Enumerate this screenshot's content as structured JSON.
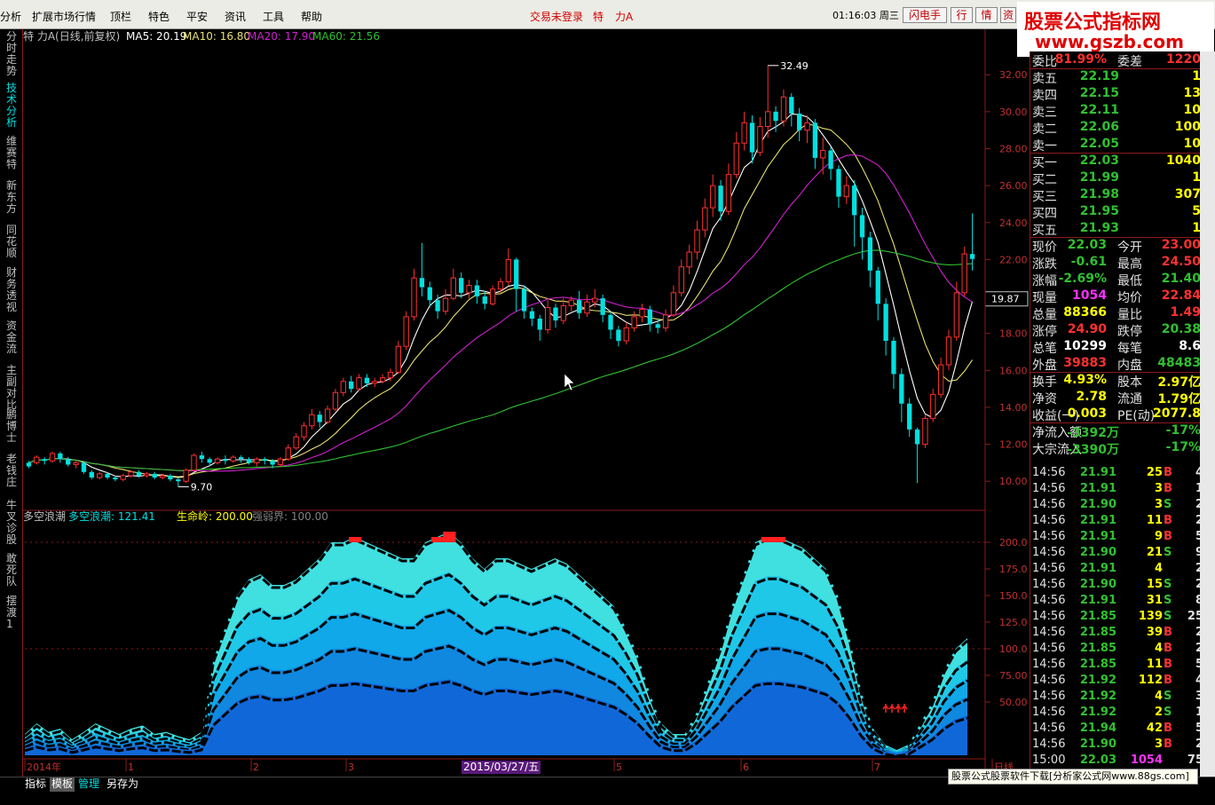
{
  "menubar": {
    "items": [
      "分析",
      "扩展市场行情",
      "顶栏",
      "特色",
      "平安",
      "资讯",
      "工具",
      "帮助"
    ],
    "center_items": [
      "交易未登录",
      "特",
      "力A"
    ],
    "clock": "01:16:03 周三",
    "buttons": [
      "闪电手",
      "行",
      "情",
      "资"
    ]
  },
  "brand": {
    "line1": "股票公式指标网",
    "line2": "www.gszb.com"
  },
  "side_tabs": [
    "分时走势",
    "技术分析",
    "维赛特",
    "新东方",
    "同花顺",
    "财务透视",
    "资金流",
    "主副对比",
    "鹏博士",
    "老钱庄",
    "牛叉诊股",
    "敢死队",
    "摆渡1"
  ],
  "main_chart": {
    "header": {
      "name": "特  力A(日线,前复权)",
      "ma5": "MA5: 20.19",
      "ma10": "MA10: 16.80",
      "ma20": "MA20: 17.90",
      "ma60": "MA60: 21.56"
    },
    "price_axis_ticks": [
      "32.00",
      "30.00",
      "28.00",
      "26.00",
      "24.00",
      "22.00",
      "20.00",
      "18.00",
      "16.00",
      "14.00",
      "12.00",
      "10.00"
    ],
    "price_min": 9.0,
    "price_max": 33.5,
    "high_marker": "32.49",
    "low_marker": "9.70",
    "cursor_price": "19.87",
    "colors": {
      "up": "#ff3030",
      "down": "#00e0e0",
      "ma5": "#ffffff",
      "ma10": "#e8e070",
      "ma20": "#d020d0",
      "ma60": "#30c030"
    }
  },
  "indicator": {
    "title": "多空浪潮",
    "value_label": "多空浪潮: 121.41",
    "life_label": "生命岭: 200.00",
    "strength_label": "强弱界: 100.00",
    "axis_ticks": [
      "200.0",
      "175.0",
      "150.0",
      "125.0",
      "100.0",
      "75.00",
      "50.00"
    ],
    "max": 215,
    "wave_values": [
      20,
      30,
      22,
      25,
      15,
      22,
      30,
      25,
      20,
      25,
      28,
      20,
      22,
      18,
      15,
      22,
      90,
      120,
      150,
      165,
      170,
      160,
      160,
      165,
      175,
      185,
      200,
      200,
      205,
      200,
      195,
      190,
      185,
      185,
      200,
      205,
      210,
      200,
      185,
      175,
      185,
      185,
      180,
      175,
      180,
      185,
      180,
      170,
      160,
      150,
      140,
      120,
      95,
      60,
      30,
      20,
      20,
      40,
      70,
      100,
      140,
      170,
      200,
      205,
      205,
      200,
      195,
      185,
      175,
      150,
      110,
      60,
      25,
      10,
      5,
      10,
      30,
      50,
      80,
      100,
      110
    ]
  },
  "time_axis": {
    "labels": [
      "2014年",
      "1",
      "2",
      "3",
      "2015/03/27/五",
      "5",
      "6",
      "7",
      "日线"
    ]
  },
  "quote": {
    "rows": [
      {
        "k": "委比",
        "v": "81.99%",
        "k2": "委差",
        "v2": "1220",
        "vc": "#ff3030",
        "v2c": "#ff3030"
      },
      {
        "k": "卖五",
        "v": "22.19",
        "v2": "1",
        "vc": "#30c030",
        "v2c": "#ffff00"
      },
      {
        "k": "卖四",
        "v": "22.15",
        "v2": "13",
        "vc": "#30c030",
        "v2c": "#ffff00"
      },
      {
        "k": "卖三",
        "v": "22.11",
        "v2": "10",
        "vc": "#30c030",
        "v2c": "#ffff00"
      },
      {
        "k": "卖二",
        "v": "22.06",
        "v2": "100",
        "vc": "#30c030",
        "v2c": "#ffff00"
      },
      {
        "k": "卖一",
        "v": "22.05",
        "v2": "10",
        "vc": "#30c030",
        "v2c": "#ffff00"
      },
      {
        "k": "买一",
        "v": "22.03",
        "v2": "1040",
        "vc": "#30c030",
        "v2c": "#ffff00"
      },
      {
        "k": "买二",
        "v": "21.99",
        "v2": "1",
        "vc": "#30c030",
        "v2c": "#ffff00"
      },
      {
        "k": "买三",
        "v": "21.98",
        "v2": "307",
        "vc": "#30c030",
        "v2c": "#ffff00"
      },
      {
        "k": "买四",
        "v": "21.95",
        "v2": "5",
        "vc": "#30c030",
        "v2c": "#ffff00"
      },
      {
        "k": "买五",
        "v": "21.93",
        "v2": "1",
        "vc": "#30c030",
        "v2c": "#ffff00"
      },
      {
        "k": "现价",
        "v": "22.03",
        "k2": "今开",
        "v2": "23.00",
        "vc": "#30c030",
        "v2c": "#ff3030"
      },
      {
        "k": "涨跌",
        "v": "-0.61",
        "k2": "最高",
        "v2": "24.50",
        "vc": "#30c030",
        "v2c": "#ff3030"
      },
      {
        "k": "涨幅",
        "v": "-2.69%",
        "k2": "最低",
        "v2": "21.40",
        "vc": "#30c030",
        "v2c": "#30c030"
      },
      {
        "k": "现量",
        "v": "1054",
        "k2": "均价",
        "v2": "22.84",
        "vc": "#ff30ff",
        "v2c": "#ff3030"
      },
      {
        "k": "总量",
        "v": "88366",
        "k2": "量比",
        "v2": "1.49",
        "vc": "#ffff00",
        "v2c": "#ff3030"
      },
      {
        "k": "涨停",
        "v": "24.90",
        "k2": "跌停",
        "v2": "20.38",
        "vc": "#ff3030",
        "v2c": "#30c030"
      },
      {
        "k": "总笔",
        "v": "10299",
        "k2": "每笔",
        "v2": "8.6",
        "vc": "#ffffff",
        "v2c": "#ffffff"
      },
      {
        "k": "外盘",
        "v": "39883",
        "k2": "内盘",
        "v2": "48483",
        "vc": "#ff3030",
        "v2c": "#30c030"
      },
      {
        "k": "换手",
        "v": "4.93%",
        "k2": "股本",
        "v2": "2.97亿",
        "vc": "#ffff00",
        "v2c": "#ffff00"
      },
      {
        "k": "净资",
        "v": "2.78",
        "k2": "流通",
        "v2": "1.79亿",
        "vc": "#ffff00",
        "v2c": "#ffff00"
      },
      {
        "k": "收益(一)",
        "v": "0.003",
        "k2": "PE(动)",
        "v2": "2077.8",
        "vc": "#ffff00",
        "v2c": "#ffff00"
      },
      {
        "k": "净流入额",
        "v": "-3392万",
        "v2": "-17%",
        "vc": "#30c030",
        "v2c": "#30c030"
      },
      {
        "k": "大宗流入",
        "v": "-3390万",
        "v2": "-17%",
        "vc": "#30c030",
        "v2c": "#30c030"
      }
    ]
  },
  "ticks": [
    {
      "t": "14:56",
      "p": "21.91",
      "v": "25",
      "s": "B",
      "n": "4"
    },
    {
      "t": "14:56",
      "p": "21.91",
      "v": "3",
      "s": "B",
      "n": "1"
    },
    {
      "t": "14:56",
      "p": "21.90",
      "v": "3",
      "s": "S",
      "n": "2"
    },
    {
      "t": "14:56",
      "p": "21.91",
      "v": "11",
      "s": "B",
      "n": "2"
    },
    {
      "t": "14:56",
      "p": "21.91",
      "v": "9",
      "s": "B",
      "n": "5"
    },
    {
      "t": "14:56",
      "p": "21.90",
      "v": "21",
      "s": "S",
      "n": "9"
    },
    {
      "t": "14:56",
      "p": "21.91",
      "v": "4",
      "s": "",
      "n": "2"
    },
    {
      "t": "14:56",
      "p": "21.90",
      "v": "15",
      "s": "S",
      "n": "2"
    },
    {
      "t": "14:56",
      "p": "21.91",
      "v": "31",
      "s": "S",
      "n": "8"
    },
    {
      "t": "14:56",
      "p": "21.85",
      "v": "139",
      "s": "S",
      "n": "25"
    },
    {
      "t": "14:56",
      "p": "21.85",
      "v": "39",
      "s": "B",
      "n": "2"
    },
    {
      "t": "14:56",
      "p": "21.85",
      "v": "4",
      "s": "B",
      "n": "2"
    },
    {
      "t": "14:56",
      "p": "21.85",
      "v": "11",
      "s": "B",
      "n": "5"
    },
    {
      "t": "14:56",
      "p": "21.92",
      "v": "112",
      "s": "B",
      "n": "4"
    },
    {
      "t": "14:56",
      "p": "21.92",
      "v": "4",
      "s": "S",
      "n": "3"
    },
    {
      "t": "14:56",
      "p": "21.92",
      "v": "2",
      "s": "S",
      "n": "1"
    },
    {
      "t": "14:56",
      "p": "21.94",
      "v": "42",
      "s": "B",
      "n": "5"
    },
    {
      "t": "14:56",
      "p": "21.90",
      "v": "3",
      "s": "B",
      "n": "2"
    },
    {
      "t": "15:00",
      "p": "22.03",
      "v": "1054",
      "s": "",
      "n": "75"
    }
  ],
  "bottom_tabs": [
    "指标",
    "模板",
    "管理",
    "另存为"
  ],
  "footer_ad": "股票公式股票软件下载[分析家公式网www.88gs.com]",
  "candles": [
    [
      10.8,
      11.0,
      10.7,
      11.1,
      "d"
    ],
    [
      11.0,
      11.3,
      10.9,
      11.4,
      "u"
    ],
    [
      11.2,
      11.1,
      10.9,
      11.3,
      "d"
    ],
    [
      11.1,
      11.5,
      11.0,
      11.6,
      "u"
    ],
    [
      11.5,
      11.2,
      11.0,
      11.6,
      "d"
    ],
    [
      11.2,
      10.9,
      10.8,
      11.3,
      "d"
    ],
    [
      10.9,
      11.0,
      10.7,
      11.1,
      "u"
    ],
    [
      11.0,
      10.5,
      10.4,
      11.0,
      "d"
    ],
    [
      10.5,
      10.2,
      10.1,
      10.6,
      "d"
    ],
    [
      10.2,
      10.4,
      10.1,
      10.5,
      "u"
    ],
    [
      10.4,
      10.2,
      10.1,
      10.5,
      "d"
    ],
    [
      10.2,
      10.1,
      10.0,
      10.3,
      "d"
    ],
    [
      10.1,
      10.3,
      10.0,
      10.4,
      "u"
    ],
    [
      10.3,
      10.5,
      10.2,
      10.6,
      "u"
    ],
    [
      10.5,
      10.3,
      10.2,
      10.6,
      "d"
    ],
    [
      10.3,
      10.4,
      10.2,
      10.5,
      "u"
    ],
    [
      10.4,
      10.2,
      10.1,
      10.5,
      "d"
    ],
    [
      10.2,
      10.3,
      10.1,
      10.4,
      "u"
    ],
    [
      10.3,
      10.1,
      10.0,
      10.4,
      "d"
    ],
    [
      10.1,
      10.0,
      9.7,
      10.2,
      "d"
    ],
    [
      10.0,
      10.6,
      9.9,
      10.7,
      "u"
    ],
    [
      10.6,
      11.4,
      10.5,
      11.5,
      "u"
    ],
    [
      11.4,
      11.2,
      11.0,
      11.6,
      "d"
    ],
    [
      11.2,
      11.0,
      10.8,
      11.3,
      "d"
    ],
    [
      11.0,
      11.2,
      10.9,
      11.3,
      "u"
    ],
    [
      11.2,
      11.1,
      10.9,
      11.4,
      "d"
    ],
    [
      11.1,
      11.3,
      11.0,
      11.4,
      "u"
    ],
    [
      11.3,
      11.2,
      11.0,
      11.4,
      "d"
    ],
    [
      11.2,
      11.0,
      10.9,
      11.3,
      "d"
    ],
    [
      11.0,
      11.2,
      10.8,
      11.3,
      "u"
    ],
    [
      11.2,
      11.1,
      10.9,
      11.3,
      "d"
    ],
    [
      11.1,
      10.9,
      10.7,
      11.2,
      "d"
    ],
    [
      10.9,
      11.2,
      10.8,
      11.3,
      "u"
    ],
    [
      11.2,
      11.8,
      11.1,
      12.0,
      "u"
    ],
    [
      11.8,
      12.4,
      11.7,
      12.6,
      "u"
    ],
    [
      12.4,
      13.0,
      12.2,
      13.2,
      "u"
    ],
    [
      13.0,
      13.6,
      12.8,
      13.9,
      "u"
    ],
    [
      13.6,
      13.2,
      12.9,
      13.8,
      "d"
    ],
    [
      13.2,
      13.9,
      13.1,
      14.1,
      "u"
    ],
    [
      13.9,
      14.8,
      13.8,
      15.0,
      "u"
    ],
    [
      14.8,
      15.4,
      14.6,
      15.6,
      "u"
    ],
    [
      15.4,
      15.0,
      14.8,
      15.7,
      "d"
    ],
    [
      15.0,
      15.6,
      14.9,
      15.8,
      "u"
    ],
    [
      15.6,
      15.3,
      15.1,
      15.8,
      "d"
    ],
    [
      15.3,
      15.4,
      15.1,
      15.6,
      "u"
    ],
    [
      15.4,
      15.6,
      15.3,
      15.8,
      "u"
    ],
    [
      15.6,
      15.9,
      15.4,
      16.1,
      "u"
    ],
    [
      15.9,
      17.3,
      15.8,
      17.6,
      "u"
    ],
    [
      17.3,
      18.9,
      17.1,
      19.2,
      "u"
    ],
    [
      18.9,
      21.0,
      18.7,
      21.5,
      "u"
    ],
    [
      21.0,
      20.5,
      20.0,
      22.9,
      "d"
    ],
    [
      20.5,
      19.8,
      19.4,
      20.8,
      "d"
    ],
    [
      19.8,
      19.2,
      18.8,
      20.1,
      "d"
    ],
    [
      19.2,
      19.9,
      19.0,
      20.4,
      "u"
    ],
    [
      19.9,
      21.0,
      19.8,
      21.5,
      "u"
    ],
    [
      21.0,
      20.2,
      19.9,
      21.3,
      "d"
    ],
    [
      20.2,
      20.6,
      19.9,
      20.9,
      "u"
    ],
    [
      20.6,
      20.0,
      19.6,
      20.9,
      "d"
    ],
    [
      20.0,
      19.6,
      19.3,
      20.3,
      "d"
    ],
    [
      19.6,
      20.4,
      19.5,
      20.6,
      "u"
    ],
    [
      20.4,
      20.8,
      20.2,
      21.0,
      "u"
    ],
    [
      20.8,
      22.0,
      20.6,
      22.6,
      "u"
    ],
    [
      22.0,
      20.4,
      19.2,
      22.1,
      "d"
    ],
    [
      20.4,
      19.2,
      18.8,
      20.6,
      "d"
    ],
    [
      19.2,
      18.8,
      18.4,
      19.4,
      "d"
    ],
    [
      18.8,
      18.2,
      17.6,
      19.0,
      "d"
    ],
    [
      18.2,
      19.4,
      18.0,
      19.8,
      "u"
    ],
    [
      19.4,
      18.7,
      18.3,
      19.6,
      "d"
    ],
    [
      18.7,
      19.5,
      18.5,
      19.9,
      "u"
    ],
    [
      19.5,
      19.8,
      19.2,
      20.0,
      "u"
    ],
    [
      19.8,
      19.1,
      18.8,
      20.3,
      "d"
    ],
    [
      19.1,
      19.7,
      18.9,
      20.1,
      "u"
    ],
    [
      19.7,
      19.9,
      19.4,
      20.4,
      "u"
    ],
    [
      19.9,
      19.0,
      18.6,
      20.1,
      "d"
    ],
    [
      19.0,
      18.2,
      17.7,
      19.2,
      "d"
    ],
    [
      18.2,
      17.6,
      17.3,
      18.4,
      "d"
    ],
    [
      17.6,
      18.3,
      17.4,
      18.6,
      "u"
    ],
    [
      18.3,
      18.9,
      18.1,
      19.2,
      "u"
    ],
    [
      18.9,
      19.3,
      18.6,
      19.6,
      "u"
    ],
    [
      19.3,
      18.5,
      18.1,
      19.5,
      "d"
    ],
    [
      18.5,
      18.3,
      18.0,
      18.8,
      "d"
    ],
    [
      18.3,
      19.0,
      18.1,
      19.3,
      "u"
    ],
    [
      19.0,
      20.2,
      18.9,
      20.6,
      "u"
    ],
    [
      20.2,
      21.6,
      20.0,
      22.0,
      "u"
    ],
    [
      21.6,
      22.4,
      21.2,
      22.8,
      "u"
    ],
    [
      22.4,
      23.6,
      22.0,
      24.1,
      "u"
    ],
    [
      23.6,
      24.8,
      23.2,
      25.3,
      "u"
    ],
    [
      24.8,
      26.0,
      24.3,
      26.6,
      "u"
    ],
    [
      26.0,
      24.6,
      24.1,
      26.3,
      "d"
    ],
    [
      24.6,
      26.6,
      24.4,
      27.2,
      "u"
    ],
    [
      26.6,
      28.3,
      26.4,
      28.9,
      "u"
    ],
    [
      28.3,
      29.4,
      27.9,
      30.0,
      "u"
    ],
    [
      29.4,
      27.8,
      27.2,
      29.8,
      "d"
    ],
    [
      27.8,
      29.2,
      27.6,
      29.7,
      "u"
    ],
    [
      29.2,
      30.0,
      28.6,
      32.5,
      "u"
    ],
    [
      30.0,
      29.5,
      28.9,
      30.3,
      "d"
    ],
    [
      29.5,
      30.8,
      29.2,
      31.2,
      "u"
    ],
    [
      30.8,
      29.9,
      29.2,
      31.0,
      "d"
    ],
    [
      29.9,
      29.0,
      28.4,
      30.2,
      "d"
    ],
    [
      29.0,
      29.4,
      28.3,
      29.8,
      "u"
    ],
    [
      29.4,
      27.5,
      26.9,
      29.6,
      "d"
    ],
    [
      27.5,
      27.9,
      26.6,
      28.6,
      "u"
    ],
    [
      27.9,
      26.9,
      26.3,
      28.1,
      "d"
    ],
    [
      26.9,
      25.4,
      24.8,
      27.1,
      "d"
    ],
    [
      25.4,
      26.0,
      25.0,
      26.5,
      "u"
    ],
    [
      26.0,
      24.4,
      22.7,
      26.3,
      "d"
    ],
    [
      24.4,
      23.2,
      22.0,
      24.8,
      "d"
    ],
    [
      23.2,
      21.4,
      20.5,
      23.5,
      "d"
    ],
    [
      21.4,
      19.6,
      18.7,
      21.6,
      "d"
    ],
    [
      19.6,
      17.6,
      16.8,
      19.9,
      "d"
    ],
    [
      17.6,
      15.8,
      15.0,
      17.8,
      "d"
    ],
    [
      15.8,
      14.2,
      13.2,
      16.1,
      "d"
    ],
    [
      14.2,
      12.8,
      12.4,
      14.5,
      "d"
    ],
    [
      12.8,
      12.0,
      9.9,
      12.9,
      "d"
    ],
    [
      12.0,
      13.4,
      11.8,
      13.6,
      "u"
    ],
    [
      13.4,
      14.7,
      13.2,
      15.0,
      "u"
    ],
    [
      14.7,
      16.3,
      14.5,
      16.7,
      "u"
    ],
    [
      16.3,
      17.8,
      16.0,
      18.2,
      "u"
    ],
    [
      17.8,
      20.2,
      17.6,
      20.8,
      "u"
    ],
    [
      20.2,
      22.3,
      20.0,
      22.7,
      "u"
    ],
    [
      22.3,
      22.03,
      21.4,
      24.5,
      "d"
    ]
  ]
}
